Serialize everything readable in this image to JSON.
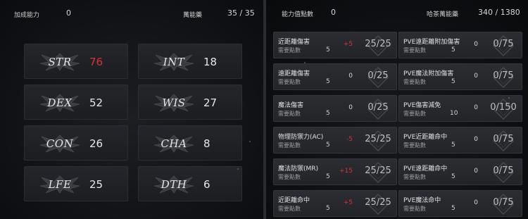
{
  "left": {
    "bonus_label": "加成能力",
    "bonus_value": "0",
    "elixir_label": "萬能藥",
    "elixir_value": "35 / 35",
    "stats": [
      {
        "name": "STR",
        "value": "76",
        "highlight": true
      },
      {
        "name": "INT",
        "value": "18",
        "highlight": false
      },
      {
        "name": "DEX",
        "value": "52",
        "highlight": false
      },
      {
        "name": "WIS",
        "value": "27",
        "highlight": false
      },
      {
        "name": "CON",
        "value": "26",
        "highlight": false
      },
      {
        "name": "CHA",
        "value": "8",
        "highlight": false
      },
      {
        "name": "LFE",
        "value": "25",
        "highlight": false
      },
      {
        "name": "DTH",
        "value": "6",
        "highlight": false
      }
    ]
  },
  "right": {
    "points_label": "能力值點數",
    "points_value": "0",
    "elixir_label": "哈茶萬能藥",
    "elixir_value": "340 / 1380",
    "col1": [
      {
        "label": "近距離傷害",
        "pts_label": "需要點數",
        "pts": "5",
        "bonus": "+5",
        "bonus_red": true,
        "level": "25/25"
      },
      {
        "label": "遠距離傷害",
        "pts_label": "需要點數",
        "pts": "5",
        "bonus": "0",
        "bonus_red": false,
        "level": "0/25"
      },
      {
        "label": "魔法傷害",
        "pts_label": "需要點數",
        "pts": "5",
        "bonus": "0",
        "bonus_red": false,
        "level": "0/25"
      },
      {
        "label": "物理防禦力(AC)",
        "pts_label": "需要點數",
        "pts": "5",
        "bonus": "-5",
        "bonus_red": true,
        "level": "25/25"
      },
      {
        "label": "魔法防禦(MR)",
        "pts_label": "需要點數",
        "pts": "5",
        "bonus": "+15",
        "bonus_red": true,
        "level": "25/25"
      },
      {
        "label": "近距離命中",
        "pts_label": "需要點數",
        "pts": "5",
        "bonus": "+5",
        "bonus_red": true,
        "level": "25/25"
      }
    ],
    "col2": [
      {
        "label": "PVE遠距離附加傷害",
        "pts_label": "需要點數",
        "pts": "5",
        "bonus": "0",
        "bonus_red": false,
        "level": "0/75"
      },
      {
        "label": "PVE魔法附加傷害",
        "pts_label": "需要點數",
        "pts": "5",
        "bonus": "0",
        "bonus_red": false,
        "level": "0/75"
      },
      {
        "label": "PVE傷害減免",
        "pts_label": "需要點數",
        "pts": "10",
        "bonus": "0",
        "bonus_red": false,
        "level": "0/150"
      },
      {
        "label": "PVE近距離命中",
        "pts_label": "需要點數",
        "pts": "5",
        "bonus": "0",
        "bonus_red": false,
        "level": "0/75"
      },
      {
        "label": "PVE遠距離命中",
        "pts_label": "需要點數",
        "pts": "5",
        "bonus": "0",
        "bonus_red": false,
        "level": "0/75"
      },
      {
        "label": "PVE魔法命中",
        "pts_label": "需要點數",
        "pts": "5",
        "bonus": "0",
        "bonus_red": false,
        "level": "0/75"
      }
    ]
  },
  "icons": {
    "stat_emblem": "winged-emblem-icon",
    "level_diamond": "diamond-frame-icon"
  }
}
